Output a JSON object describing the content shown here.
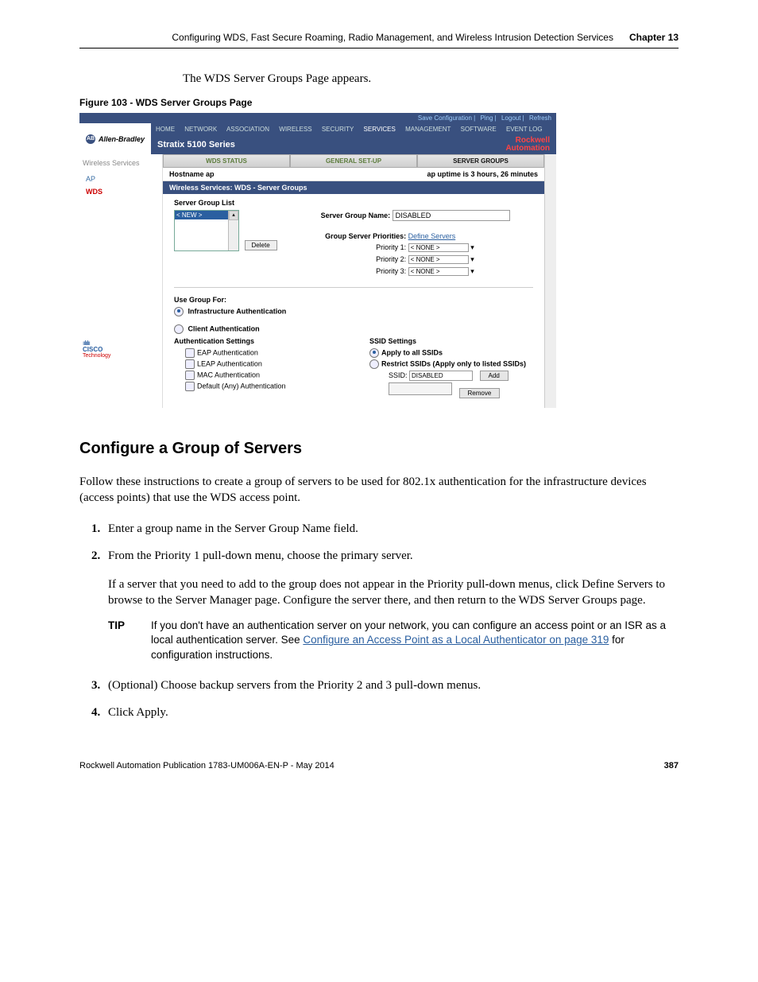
{
  "header": {
    "title": "Configuring WDS, Fast Secure Roaming, Radio Management, and Wireless Intrusion Detection Services",
    "chapter": "Chapter 13"
  },
  "intro": "The WDS Server Groups Page appears.",
  "figure_caption": "Figure 103 - WDS Server Groups Page",
  "ss": {
    "top_links": [
      "Save Configuration",
      "Ping",
      "Logout",
      "Refresh"
    ],
    "tabs": [
      "HOME",
      "NETWORK",
      "ASSOCIATION",
      "WIRELESS",
      "SECURITY",
      "SERVICES",
      "MANAGEMENT",
      "SOFTWARE",
      "EVENT LOG"
    ],
    "brand_left": "Allen-Bradley",
    "product": "Stratix 5100 Series",
    "brand_right_1": "Rockwell",
    "brand_right_2": "Automation",
    "sidebar": {
      "section": "Wireless Services",
      "items": [
        "AP",
        "WDS"
      ],
      "active_index": 1
    },
    "subtabs": [
      "WDS STATUS",
      "GENERAL SET-UP",
      "SERVER GROUPS"
    ],
    "hostname_label": "Hostname ap",
    "uptime": "ap uptime is 3 hours, 26 minutes",
    "section_header": "Wireless Services: WDS - Server Groups",
    "list_label": "Server Group List",
    "list_new": "< NEW >",
    "delete_label": "Delete",
    "group_name_label": "Server Group Name:",
    "group_name_value": "DISABLED",
    "priorities_label": "Group Server Priorities:",
    "define_servers": "Define Servers",
    "priority_rows": [
      {
        "label": "Priority 1:",
        "value": "< NONE >"
      },
      {
        "label": "Priority 2:",
        "value": "< NONE >"
      },
      {
        "label": "Priority 3:",
        "value": "< NONE >"
      }
    ],
    "use_group_for": "Use Group For:",
    "infra_auth": "Infrastructure Authentication",
    "client_auth": "Client Authentication",
    "auth_settings_hdr": "Authentication Settings",
    "auth_opts": [
      "EAP Authentication",
      "LEAP Authentication",
      "MAC Authentication",
      "Default (Any) Authentication"
    ],
    "ssid_settings_hdr": "SSID Settings",
    "apply_all": "Apply to all SSIDs",
    "restrict": "Restrict SSIDs (Apply only to listed SSIDs)",
    "ssid_label": "SSID:",
    "ssid_value": "DISABLED",
    "add_btn": "Add",
    "remove_btn": "Remove"
  },
  "section_heading": "Configure a Group of Servers",
  "para1": "Follow these instructions to create a group of servers to be used for 802.1x authentication for the infrastructure devices (access points) that use the WDS access point.",
  "steps": {
    "s1": "Enter a group name in the Server Group Name field.",
    "s2": "From the Priority 1 pull-down menu, choose the primary server.",
    "s2_sub": "If a server that you need to add to the group does not appear in the Priority pull-down menus, click Define Servers to browse to the Server Manager page. Configure the server there, and then return to the WDS Server Groups page.",
    "s3": "(Optional) Choose backup servers from the Priority 2 and 3 pull-down menus.",
    "s4": "Click Apply."
  },
  "tip": {
    "label": "TIP",
    "text_before": "If you don't have an authentication server on your network, you can configure an access point or an ISR as a local authentication server. See ",
    "link": "Configure an Access Point as a Local Authenticator on page 319",
    "text_after": " for configuration instructions."
  },
  "footer": {
    "pub": "Rockwell Automation Publication 1783-UM006A-EN-P - May 2014",
    "page": "387"
  }
}
